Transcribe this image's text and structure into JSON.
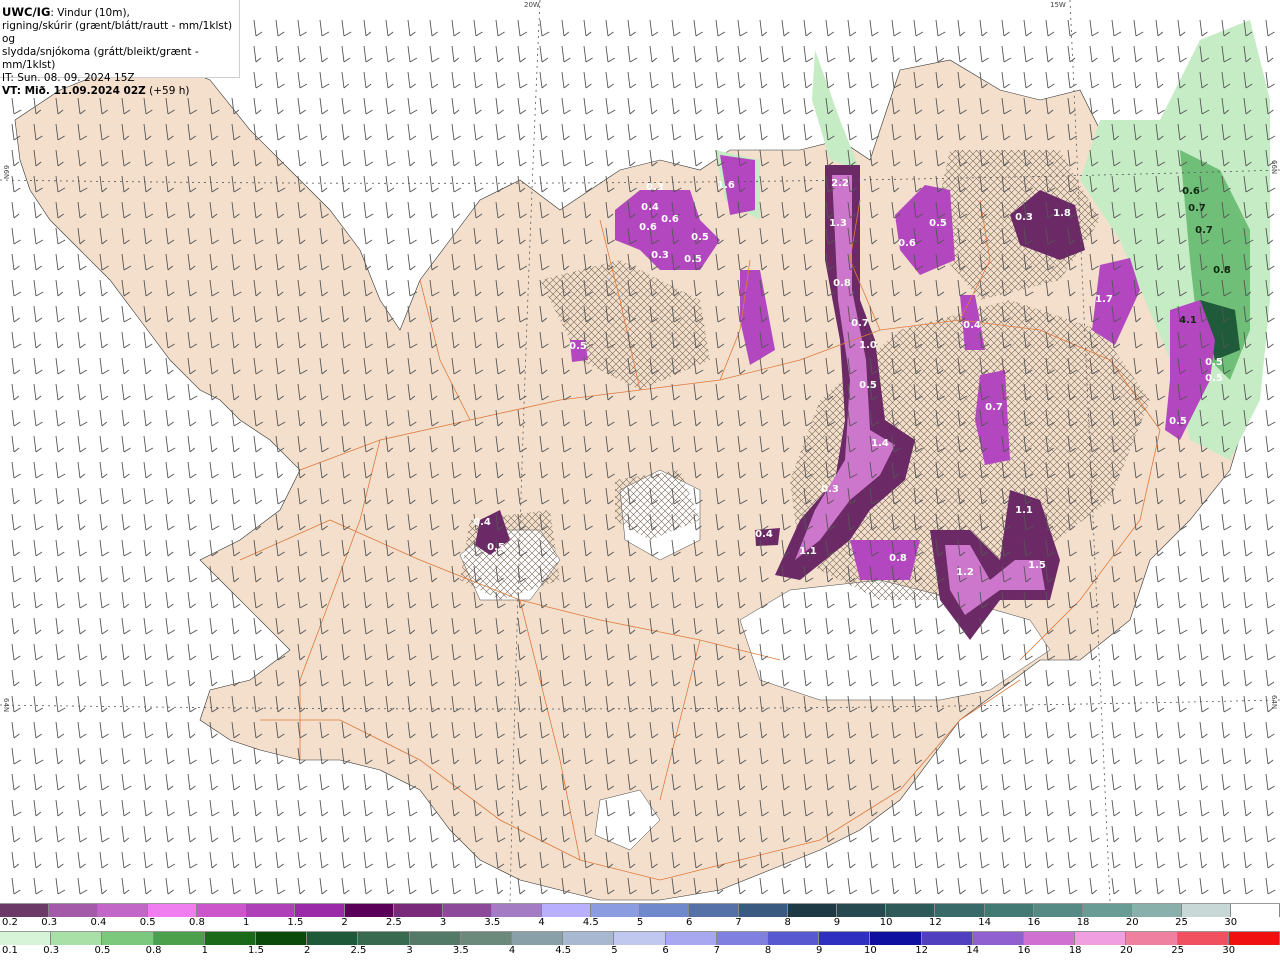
{
  "header": {
    "model": "UWC/IG",
    "line1_rest": ": Vindur (10m),",
    "line2": "rigning/skúrir (grænt/blátt/rautt - mm/1klst) og",
    "line3": "slydda/snjókoma (grátt/bleikt/grænt - mm/1klst)",
    "init_time": "IT: Sun. 08. 09. 2024 15Z",
    "valid_label": "VT: Mið. 11.09.2024 02Z",
    "lead": "(+59 h)"
  },
  "grid_labels": {
    "lon_20w": "20W",
    "lon_15w": "15W",
    "lat_66n_left": "66N",
    "lat_66n_right": "66N",
    "lat_64n_left": "64N",
    "lat_64n_right": "64N"
  },
  "colors": {
    "land": "#f3dfcc",
    "roads": "#e07a3c",
    "snow_light": "#cc77cc",
    "snow_mid": "#b347c0",
    "snow_dark": "#6b2a66",
    "rain_light": "#c6ecc6",
    "rain_mid": "#6fbf78",
    "rain_dark": "#1f5a3a",
    "wind_barb": "#555555"
  },
  "precip_labels": [
    {
      "v": "0.3"
    },
    {
      "v": "0.4"
    },
    {
      "v": "0.6"
    },
    {
      "v": "0.6"
    },
    {
      "v": "0.3"
    },
    {
      "v": "0.5"
    },
    {
      "v": "0.5"
    },
    {
      "v": "1.6"
    },
    {
      "v": "2.2"
    },
    {
      "v": "1.3"
    },
    {
      "v": "0.8"
    },
    {
      "v": "0.7"
    },
    {
      "v": "1.0"
    },
    {
      "v": "0.5"
    },
    {
      "v": "1.4"
    },
    {
      "v": "0.3"
    },
    {
      "v": "0.6"
    },
    {
      "v": "0.5"
    },
    {
      "v": "0.3"
    },
    {
      "v": "1.8"
    },
    {
      "v": "0.4"
    },
    {
      "v": "0.7"
    },
    {
      "v": "1.7"
    },
    {
      "v": "0.6"
    },
    {
      "v": "0.7"
    },
    {
      "v": "0.7"
    },
    {
      "v": "0.8"
    },
    {
      "v": "4.1"
    },
    {
      "v": "0.5"
    },
    {
      "v": "0.5"
    },
    {
      "v": "0.5"
    },
    {
      "v": "1.1"
    },
    {
      "v": "1.5"
    },
    {
      "v": "1.2"
    },
    {
      "v": "0.8"
    },
    {
      "v": "1.1"
    },
    {
      "v": "0.4"
    },
    {
      "v": "0.5"
    },
    {
      "v": "0.4"
    },
    {
      "v": "0.5"
    }
  ],
  "colorbar_snow": {
    "labels": [
      "0.2",
      "0.3",
      "0.4",
      "0.5",
      "0.8",
      "1",
      "1.5",
      "2",
      "2.5",
      "3",
      "3.5",
      "4",
      "4.5",
      "5",
      "6",
      "7",
      "8",
      "9",
      "10",
      "12",
      "14",
      "16",
      "18",
      "20",
      "25",
      "30"
    ],
    "colors": [
      "#6b3a66",
      "#a45aa8",
      "#c266c8",
      "#f07ef0",
      "#cc55cc",
      "#b040b8",
      "#9a2aa8",
      "#5a0058",
      "#7a2a7a",
      "#8e4a9a",
      "#a47cc4",
      "#b8b0ff",
      "#8c9ce0",
      "#7088cc",
      "#5670a8",
      "#3a5a80",
      "#1e3a44",
      "#274a50",
      "#2e5a5a",
      "#386a6a",
      "#447a74",
      "#568a84",
      "#6a9c96",
      "#8ab0ac",
      "#c8d8d6",
      "#ffffff"
    ]
  },
  "colorbar_rain": {
    "labels": [
      "0.1",
      "0.3",
      "0.5",
      "0.8",
      "1",
      "1.5",
      "2",
      "2.5",
      "3",
      "3.5",
      "4",
      "4.5",
      "5",
      "6",
      "7",
      "8",
      "9",
      "10",
      "12",
      "14",
      "16",
      "18",
      "20",
      "25",
      "30"
    ],
    "colors": [
      "#d8f4d8",
      "#a8e0a8",
      "#7cc87c",
      "#4ca04c",
      "#1a6a1a",
      "#0a4a0a",
      "#1e5a3a",
      "#386a50",
      "#527a66",
      "#6c8a7c",
      "#8aa0a8",
      "#a8b8d0",
      "#c0c8f0",
      "#a8a8f0",
      "#8080e0",
      "#5858d0",
      "#3030c0",
      "#1010a0",
      "#5040c0",
      "#9060d0",
      "#d070d0",
      "#f0a0e0",
      "#f080a0",
      "#f05060",
      "#f01010"
    ]
  }
}
